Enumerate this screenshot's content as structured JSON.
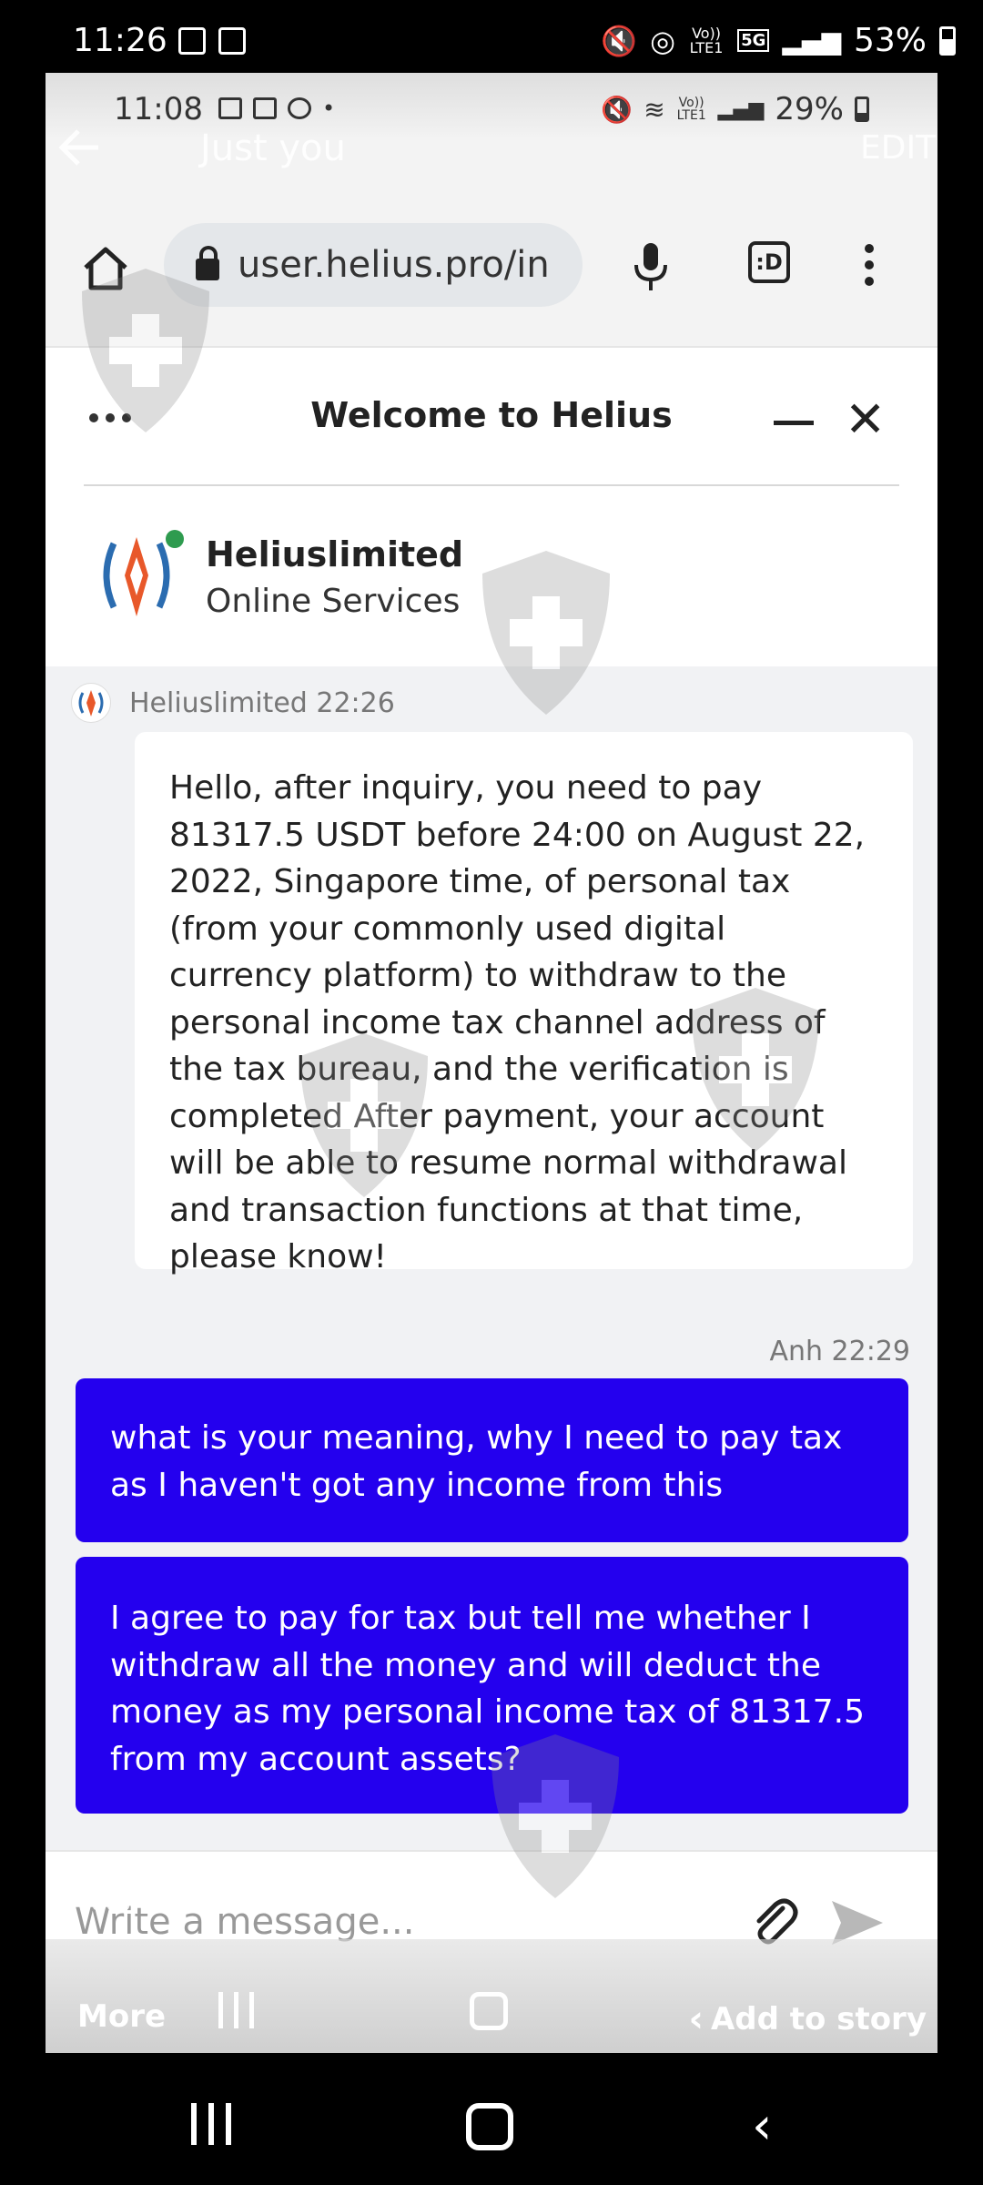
{
  "outer_status": {
    "time": "11:26",
    "network_label": "Vo)) LTE1",
    "network_type": "5G",
    "battery": "53%"
  },
  "inner_status": {
    "time": "11:08",
    "network_label": "Vo)) LTE1",
    "battery": "29%"
  },
  "story_overlay": {
    "audience": "Just you",
    "edit_label": "EDIT",
    "more_label": "More",
    "add_to_story_label": "Add to story"
  },
  "browser": {
    "url": "user.helius.pro/in"
  },
  "chat": {
    "window_title": "Welcome to Helius",
    "brand_name": "Heliuslimited",
    "brand_subtitle": "Online Services",
    "bot_sender": "Heliuslimited 22:26",
    "bot_message": "Hello, after inquiry, you need to pay 81317.5 USDT before 24:00 on August 22, 2022, Singapore time, of personal tax (from your commonly used digital currency platform) to withdraw to the personal income tax channel address of the tax bureau, and the verification is completed After payment, your account will be able to resume normal withdrawal and transaction functions at that time, please know!",
    "user_sender": "Anh 22:29",
    "user_messages": [
      "what is your meaning, why I need to pay tax as I haven't got any income from this",
      "I agree to pay for tax but tell me whether I withdraw all the money and will deduct the money as my personal income tax of 81317.5 from my account assets?"
    ],
    "compose_placeholder": "Write a message..."
  },
  "colors": {
    "user_bubble": "#2400ee",
    "online_dot": "#2e9b4f",
    "chat_background": "#f1f2f4"
  }
}
